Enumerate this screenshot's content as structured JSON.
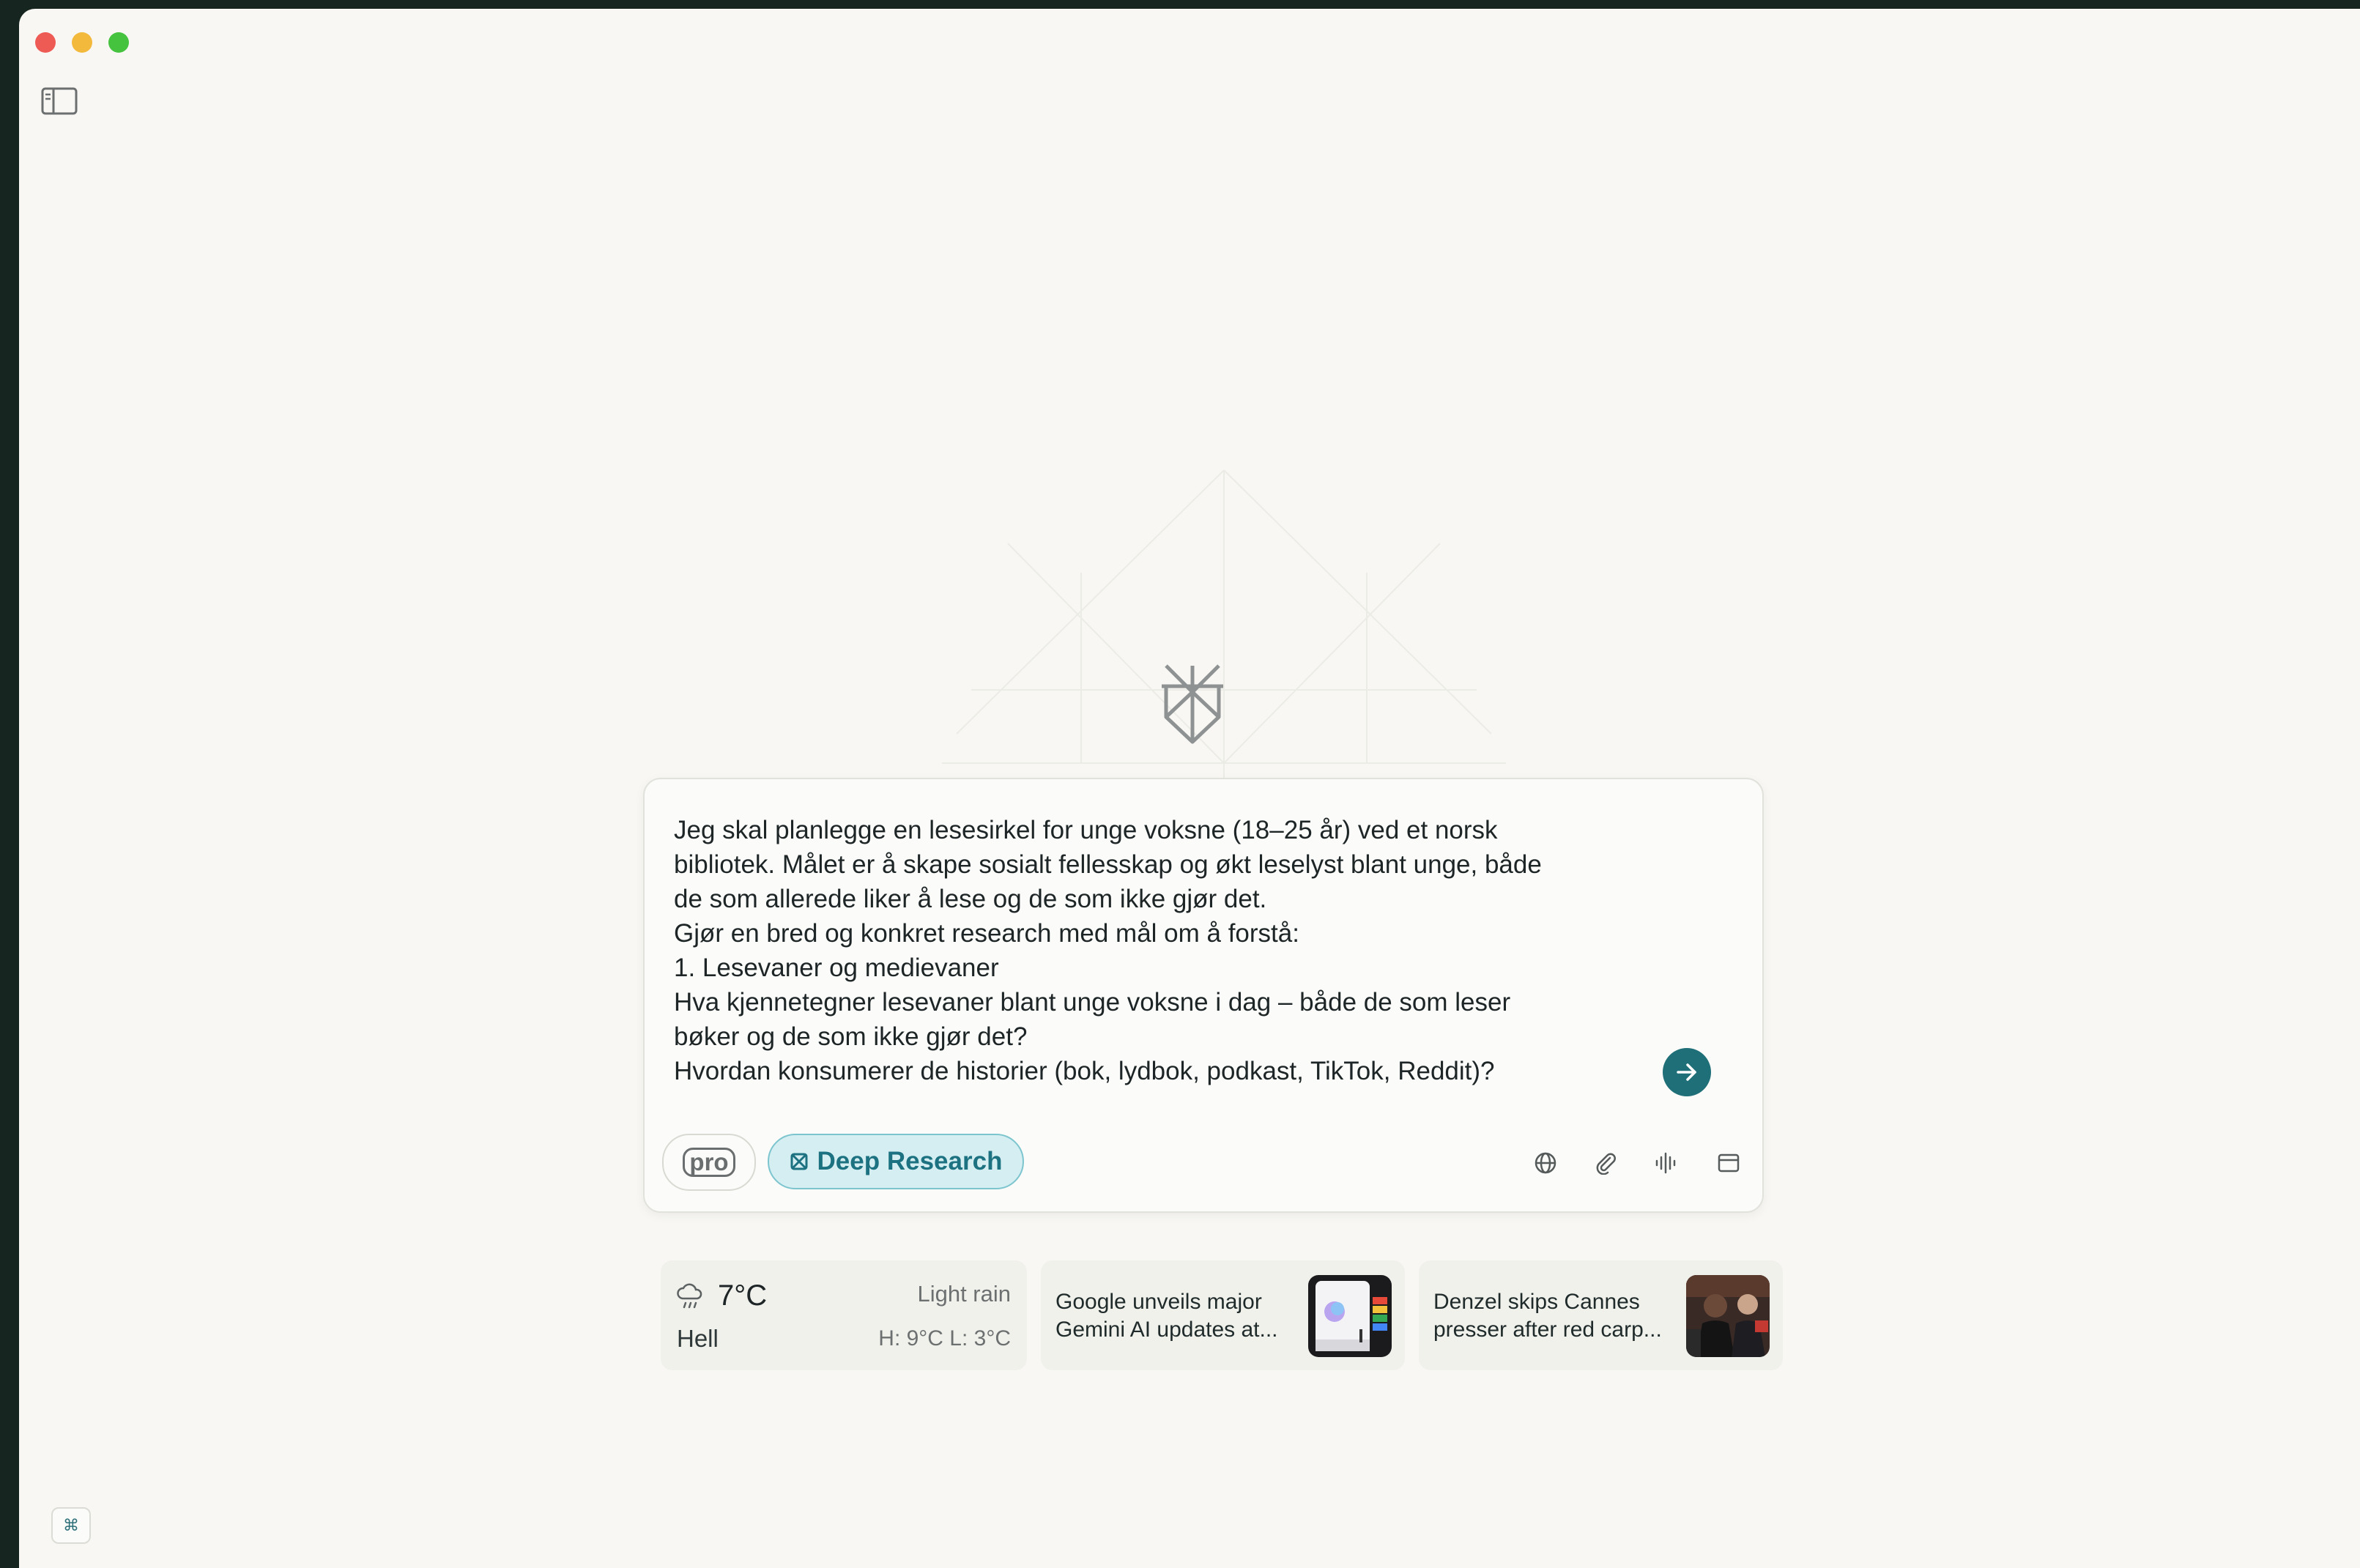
{
  "window": {
    "controls": [
      "close",
      "minimize",
      "zoom"
    ]
  },
  "sidebar": {
    "toggle_icon": "sidebar-toggle-icon"
  },
  "composer": {
    "prompt_text": "Jeg skal planlegge en lesesirkel for unge voksne (18–25 år) ved et norsk\nbibliotek. Målet er å skape sosialt fellesskap og økt leselyst blant unge, både\nde som allerede liker å lese og de som ikke gjør det.\nGjør en bred og konkret research med mål om å forstå:\n1. Lesevaner og medievaner\nHva kjennetegner lesevaner blant unge voksne i dag – både de som leser\nbøker og de som ikke gjør det?\nHvordan konsumerer de historier (bok, lydbok, podkast, TikTok, Reddit)?",
    "pro_label": "pro",
    "deep_research_label": "Deep Research",
    "tools": [
      "globe-icon",
      "paperclip-icon",
      "voice-icon",
      "browser-icon"
    ],
    "accent_color": "#1f6f78"
  },
  "weather": {
    "temperature": "7°C",
    "location": "Hell",
    "condition": "Light rain",
    "high_low": "H: 9°C L: 3°C"
  },
  "news": [
    {
      "headline": "Google unveils major Gemini AI updates at..."
    },
    {
      "headline": "Denzel skips Cannes presser after red carp..."
    }
  ],
  "shortcut": {
    "label": "⌘"
  }
}
